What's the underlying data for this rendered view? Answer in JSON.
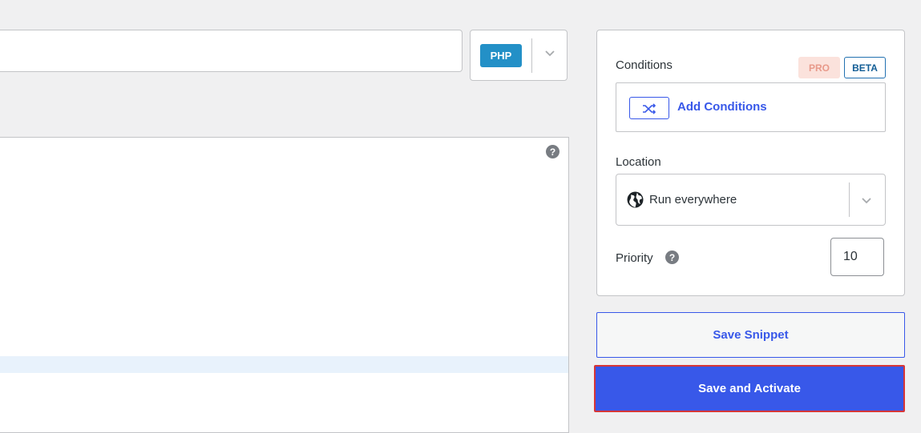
{
  "language": {
    "badge": "PHP"
  },
  "editor": {
    "help_icon": "question-circle-icon"
  },
  "sidebar": {
    "conditions": {
      "label": "Conditions",
      "pro_badge": "PRO",
      "beta_badge": "BETA",
      "add_label": "Add Conditions"
    },
    "location": {
      "label": "Location",
      "value": "Run everywhere"
    },
    "priority": {
      "label": "Priority",
      "value": "10"
    }
  },
  "buttons": {
    "save": "Save Snippet",
    "save_activate": "Save and Activate"
  },
  "colors": {
    "accent": "#3858e9",
    "php_badge": "#2390c7",
    "highlight_border": "#d63638"
  }
}
